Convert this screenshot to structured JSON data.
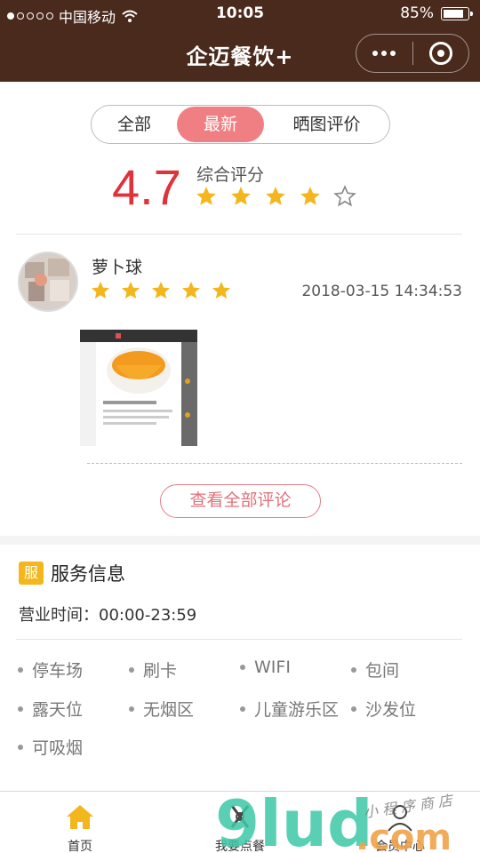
{
  "status_bar": {
    "carrier": "中国移动",
    "time": "10:05",
    "battery": "85%",
    "battery_level": 0.85
  },
  "nav": {
    "title": "企迈餐饮+"
  },
  "tabs": [
    {
      "label": "全部"
    },
    {
      "label": "最新"
    },
    {
      "label": "晒图评价"
    }
  ],
  "rating": {
    "score": "4.7",
    "label": "综合评分",
    "stars": 4,
    "max_stars": 5
  },
  "review": {
    "name": "萝卜球",
    "time": "2018-03-15 14:34:53",
    "stars": 5
  },
  "see_all_label": "查看全部评论",
  "service": {
    "badge": "服",
    "title": "服务信息",
    "hours": "营业时间：00:00-23:59",
    "facilities": [
      "停车场",
      "刷卡",
      "WIFI",
      "包间",
      "露天位",
      "无烟区",
      "儿童游乐区",
      "沙发位",
      "可吸烟"
    ]
  },
  "tabbar": [
    {
      "label": "首页",
      "icon": "home-icon"
    },
    {
      "label": "我要点餐",
      "icon": "utensils-icon"
    },
    {
      "label": "会员中心",
      "icon": "user-icon"
    }
  ],
  "watermark": {
    "text": "9lud.com",
    "caption": "小程序商店"
  },
  "colors": {
    "nav_bg": "#4a2a1c",
    "accent": "#f07f83",
    "score": "#e0323a",
    "star": "#f3b61c"
  }
}
